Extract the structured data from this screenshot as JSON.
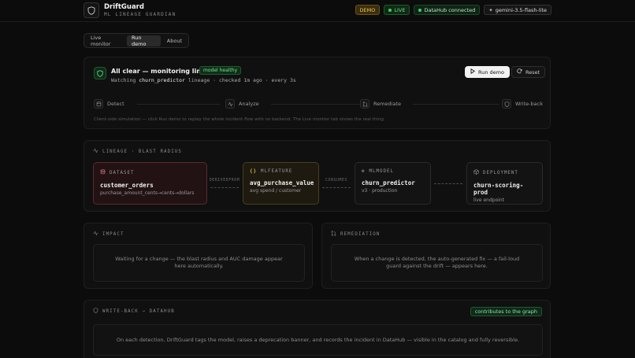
{
  "header": {
    "title": "DriftGuard",
    "subtitle": "ML LINEAGE GUARDIAN",
    "badges": {
      "demo": "DEMO",
      "live": "LIVE",
      "datahub": "DataHub connected",
      "model": "gemini-3.5-flash-lite"
    }
  },
  "tabs": [
    {
      "label": "Live monitor",
      "active": false
    },
    {
      "label": "Run demo",
      "active": true
    },
    {
      "label": "About",
      "active": false
    }
  ],
  "status": {
    "title": "All clear — monitoring lineage",
    "pill": "model healthy",
    "sub_prefix": "Watching",
    "sub_model": "churn_predictor",
    "sub_suffix": "lineage · checked 1m ago · every 3s",
    "run_button": "Run demo",
    "reset_button": "Reset",
    "steps": [
      "Detect",
      "Analyze",
      "Remediate",
      "Write-back"
    ],
    "note": "Client-side simulation — click Run demo to replay the whole incident flow with no backend. The Live monitor tab shows the real thing."
  },
  "lineage": {
    "label": "LINEAGE · BLAST RADIUS",
    "nodes": [
      {
        "kind": "DATASET",
        "name": "customer_orders",
        "desc": "purchase_amount_cents→cents→dollars"
      },
      {
        "kind": "MLFEATURE",
        "name": "avg_purchase_value",
        "desc": "avg spend / customer"
      },
      {
        "kind": "MLMODEL",
        "name": "churn_predictor",
        "desc": "v3 · production"
      },
      {
        "kind": "DEPLOYMENT",
        "name": "churn-scoring-prod",
        "desc": "live endpoint"
      }
    ],
    "edges": [
      "DERIVEDFROM",
      "CONSUMES"
    ]
  },
  "impact": {
    "label": "IMPACT",
    "body": "Waiting for a change — the blast radius and AUC damage appear here automatically."
  },
  "remediation": {
    "label": "REMEDIATION",
    "body": "When a change is detected, the auto-generated fix — a fail-loud guard against the drift — appears here."
  },
  "writeback": {
    "label": "WRITE-BACK → DATAHUB",
    "pill": "contributes to the graph",
    "body": "On each detection, DriftGuard tags the model, raises a deprecation banner, and records the incident in DataHub — visible in the catalog and fully reversible."
  },
  "colors": {
    "background": "#0c0c0c",
    "healthy_green": "#3ed262",
    "demo_amber": "#f0c44a",
    "dataset_red": "#5a2a30",
    "feature_amber": "#4a3e1c"
  }
}
